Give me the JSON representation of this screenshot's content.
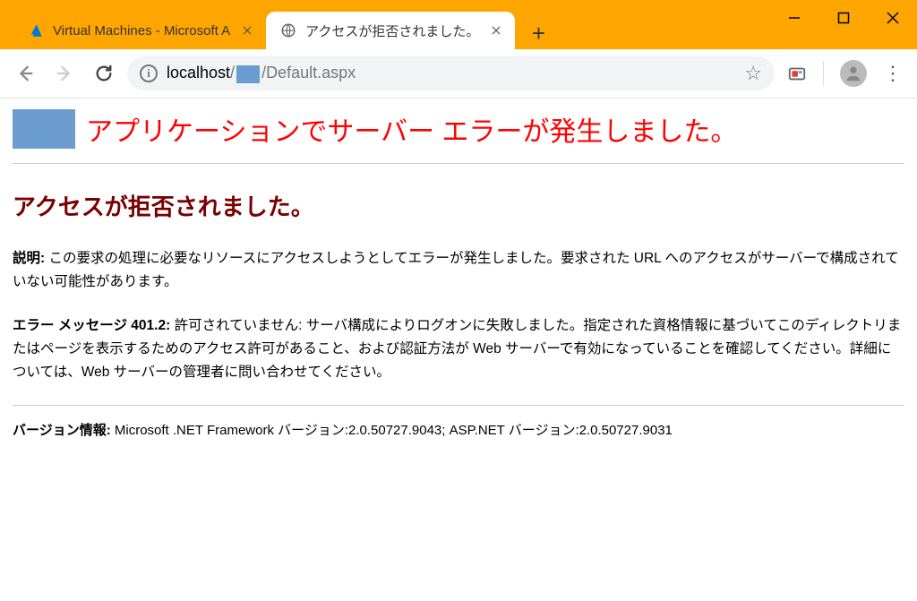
{
  "tabs": [
    {
      "title": "Virtual Machines - Microsoft A",
      "active": false,
      "favicon": "azure"
    },
    {
      "title": "アクセスが拒否されました。",
      "active": true,
      "favicon": "globe"
    }
  ],
  "addressbar": {
    "host": "localhost",
    "path_after": "/Default.aspx"
  },
  "error": {
    "page_title": "アプリケーションでサーバー エラーが発生しました。",
    "sub_title": "アクセスが拒否されました。",
    "desc_label": "説明:",
    "desc_text": "この要求の処理に必要なリソースにアクセスしようとしてエラーが発生しました。要求された URL へのアクセスがサーバーで構成されていない可能性があります。",
    "err_label": "エラー メッセージ 401.2:",
    "err_text": "許可されていません: サーバ構成によりログオンに失敗しました。指定された資格情報に基づいてこのディレクトリまたはページを表示するためのアクセス許可があること、および認証方法が Web サーバーで有効になっていることを確認してください。詳細については、Web サーバーの管理者に問い合わせてください。",
    "version_label": "バージョン情報:",
    "version_text": "Microsoft .NET Framework バージョン:2.0.50727.9043; ASP.NET バージョン:2.0.50727.9031"
  }
}
